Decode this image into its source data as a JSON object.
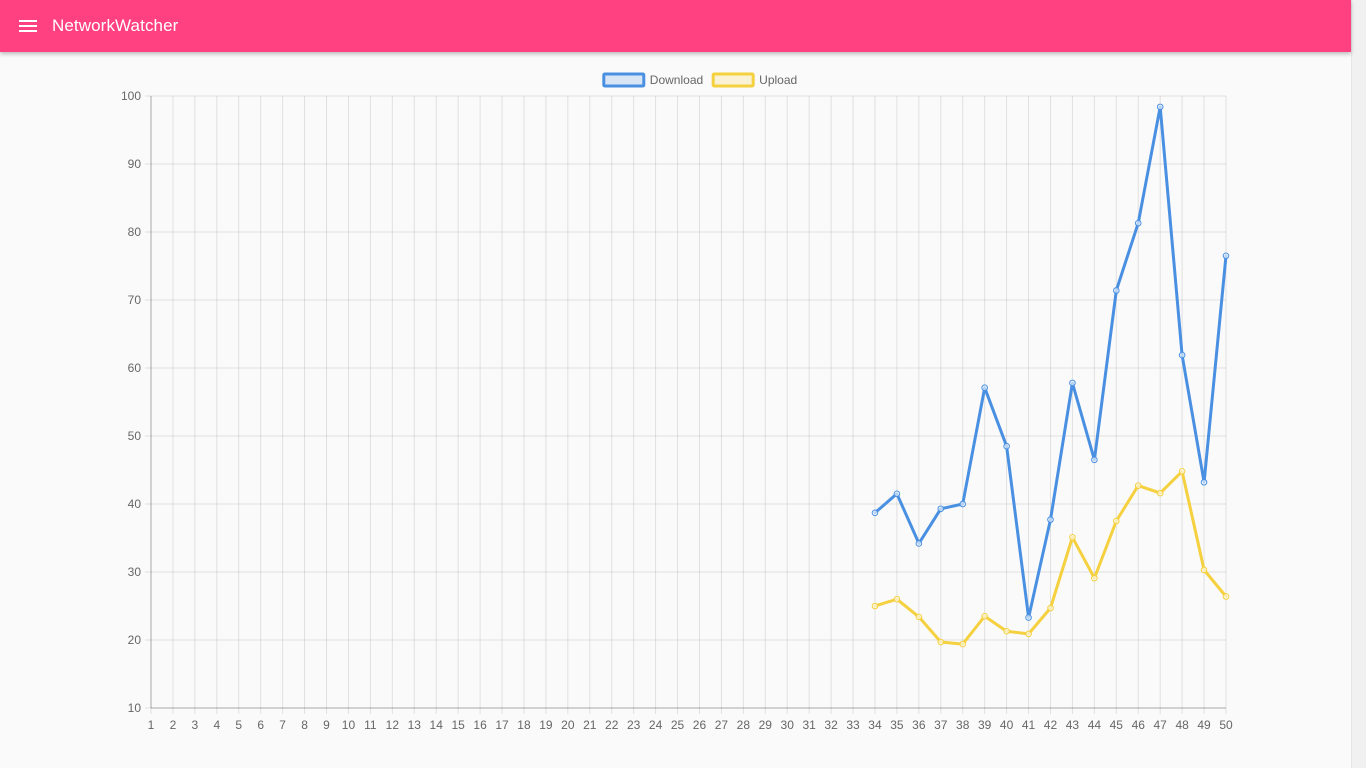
{
  "app": {
    "title": "NetworkWatcher",
    "menu_icon": "menu-icon",
    "accent_color": "#ff4081"
  },
  "chart_data": {
    "type": "line",
    "x": [
      1,
      2,
      3,
      4,
      5,
      6,
      7,
      8,
      9,
      10,
      11,
      12,
      13,
      14,
      15,
      16,
      17,
      18,
      19,
      20,
      21,
      22,
      23,
      24,
      25,
      26,
      27,
      28,
      29,
      30,
      31,
      32,
      33,
      34,
      35,
      36,
      37,
      38,
      39,
      40,
      41,
      42,
      43,
      44,
      45,
      46,
      47,
      48,
      49,
      50
    ],
    "ylim": [
      10,
      100
    ],
    "yticks": [
      10,
      20,
      30,
      40,
      50,
      60,
      70,
      80,
      90,
      100
    ],
    "grid": true,
    "legend_position": "top",
    "series": [
      {
        "name": "Download",
        "color": "#4a90e2",
        "x": [
          34,
          35,
          36,
          37,
          38,
          39,
          40,
          41,
          42,
          43,
          44,
          45,
          46,
          47,
          48,
          49,
          50
        ],
        "values": [
          38.7,
          41.5,
          34.2,
          39.3,
          40.0,
          57.1,
          48.5,
          23.3,
          37.7,
          57.8,
          46.5,
          71.4,
          81.3,
          98.4,
          61.9,
          43.2,
          76.5
        ]
      },
      {
        "name": "Upload",
        "color": "#f5d03f",
        "x": [
          34,
          35,
          36,
          37,
          38,
          39,
          40,
          41,
          42,
          43,
          44,
          45,
          46,
          47,
          48,
          49,
          50
        ],
        "values": [
          25.0,
          26.0,
          23.4,
          19.7,
          19.4,
          23.5,
          21.3,
          20.9,
          24.7,
          35.1,
          29.1,
          37.5,
          42.7,
          41.6,
          44.8,
          30.3,
          26.4
        ]
      }
    ]
  }
}
